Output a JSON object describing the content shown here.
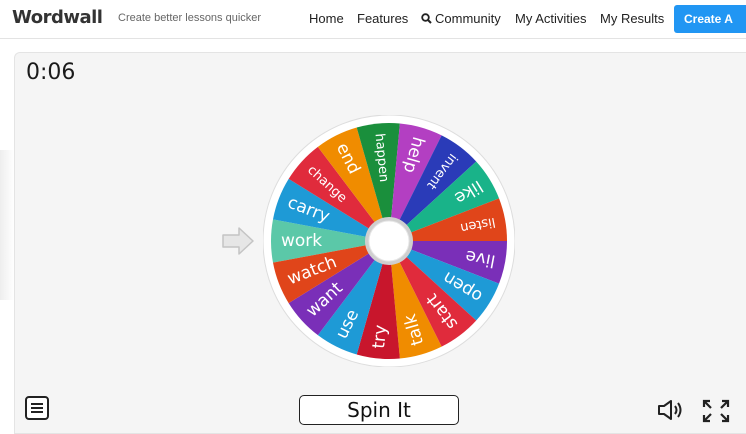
{
  "header": {
    "logo": "Wordwall",
    "tagline": "Create better lessons quicker",
    "nav": [
      "Home",
      "Features",
      "Community",
      "My Activities",
      "My Results"
    ],
    "cta_label": "Create A",
    "accent_color": "#2196f3"
  },
  "activity": {
    "timer": "0:06",
    "spin_label": "Spin It",
    "pointer_icon": "arrow-right-icon",
    "menu_icon": "menu-icon",
    "sound_icon": "speaker-icon",
    "fullscreen_icon": "fullscreen-icon"
  },
  "wheel": {
    "segments": [
      {
        "label": "work",
        "color": "#5bc8a8"
      },
      {
        "label": "carry",
        "color": "#1e9ad6"
      },
      {
        "label": "change",
        "color": "#e02b3c"
      },
      {
        "label": "end",
        "color": "#f08c00"
      },
      {
        "label": "happen",
        "color": "#1a8f3c"
      },
      {
        "label": "help",
        "color": "#b33fc2"
      },
      {
        "label": "invent",
        "color": "#2a3bb8"
      },
      {
        "label": "like",
        "color": "#19b389"
      },
      {
        "label": "listen",
        "color": "#e0451a"
      },
      {
        "label": "live",
        "color": "#7a2fb8"
      },
      {
        "label": "open",
        "color": "#1e9ad6"
      },
      {
        "label": "start",
        "color": "#e02b3c"
      },
      {
        "label": "talk",
        "color": "#f08c00"
      },
      {
        "label": "try",
        "color": "#c8162c"
      },
      {
        "label": "use",
        "color": "#1e9ad6"
      },
      {
        "label": "want",
        "color": "#7a2fb8"
      },
      {
        "label": "watch",
        "color": "#e0451a"
      }
    ]
  }
}
